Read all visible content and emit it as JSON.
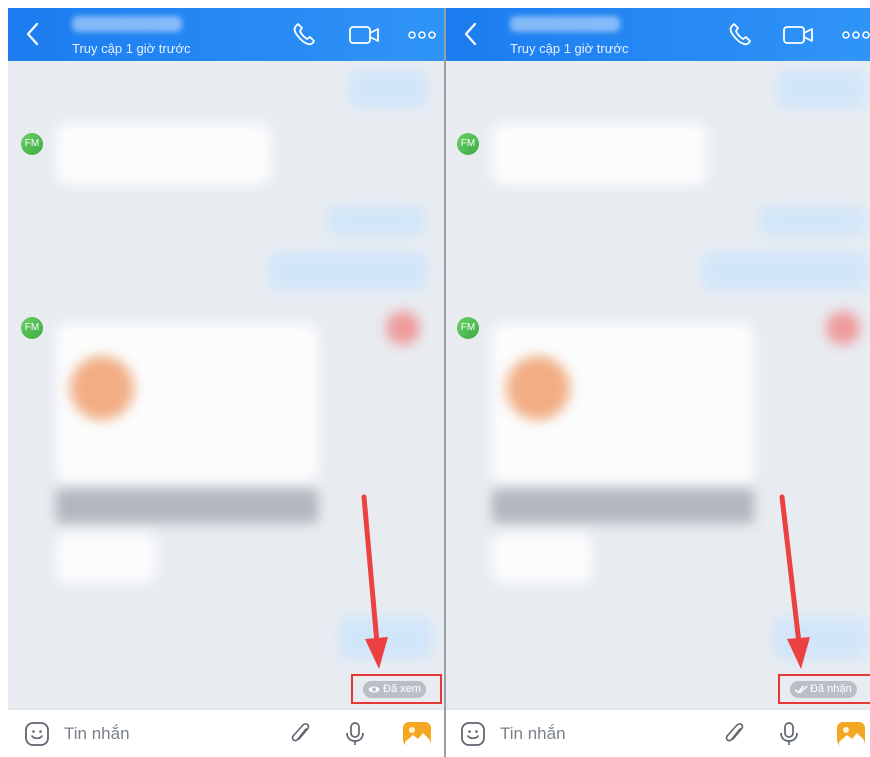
{
  "header": {
    "status_text": "Truy cập 1 giờ trước"
  },
  "avatar_initials": "FM",
  "left_panel": {
    "receipt_label": "Đã xem",
    "receipt_icon": "eye-icon"
  },
  "right_panel": {
    "receipt_label": "Đã nhận",
    "receipt_icon": "double-check-icon"
  },
  "composer": {
    "placeholder": "Tin nhắn"
  },
  "colors": {
    "header_blue": "#1c7cf0",
    "highlight_red": "#e53935",
    "arrow_red": "#ec4141",
    "avatar_green": "#4cbb4e",
    "image_icon_orange": "#f5a623"
  }
}
